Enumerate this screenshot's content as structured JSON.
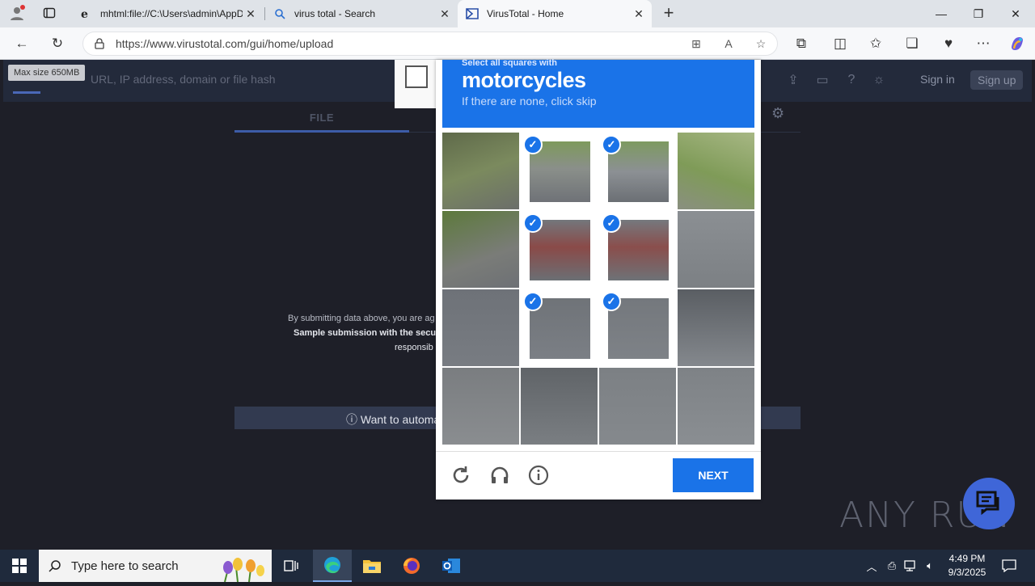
{
  "browser": {
    "tabs": [
      {
        "label": "mhtml:file://C:\\Users\\admin\\AppD",
        "icon": "ie-page-icon",
        "active": false
      },
      {
        "label": "virus total - Search",
        "icon": "search-icon",
        "active": false
      },
      {
        "label": "VirusTotal - Home",
        "icon": "virustotal-icon",
        "active": true
      }
    ],
    "url": "https://www.virustotal.com/gui/home/upload"
  },
  "virustotal": {
    "max_size": "Max size 650MB",
    "search_placeholder": "URL, IP address, domain or file hash",
    "sign_in": "Sign in",
    "sign_up": "Sign up",
    "file_tab": "FILE",
    "tos_line1": "By submitting data above, you are ag",
    "tos_line2": "Sample submission with the secu",
    "tos_line3": "responsib",
    "automate": "ⓘ Want to automa"
  },
  "captcha": {
    "prompt": "Select all squares with",
    "target": "motorcycles",
    "hint": "If there are none, click skip",
    "next_label": "NEXT",
    "selected_cells": [
      1,
      2,
      5,
      6,
      9,
      10
    ]
  },
  "watermark": "ANY RUN",
  "taskbar": {
    "search_placeholder": "Type here to search",
    "time": "4:49 PM",
    "date": "9/3/2025"
  }
}
